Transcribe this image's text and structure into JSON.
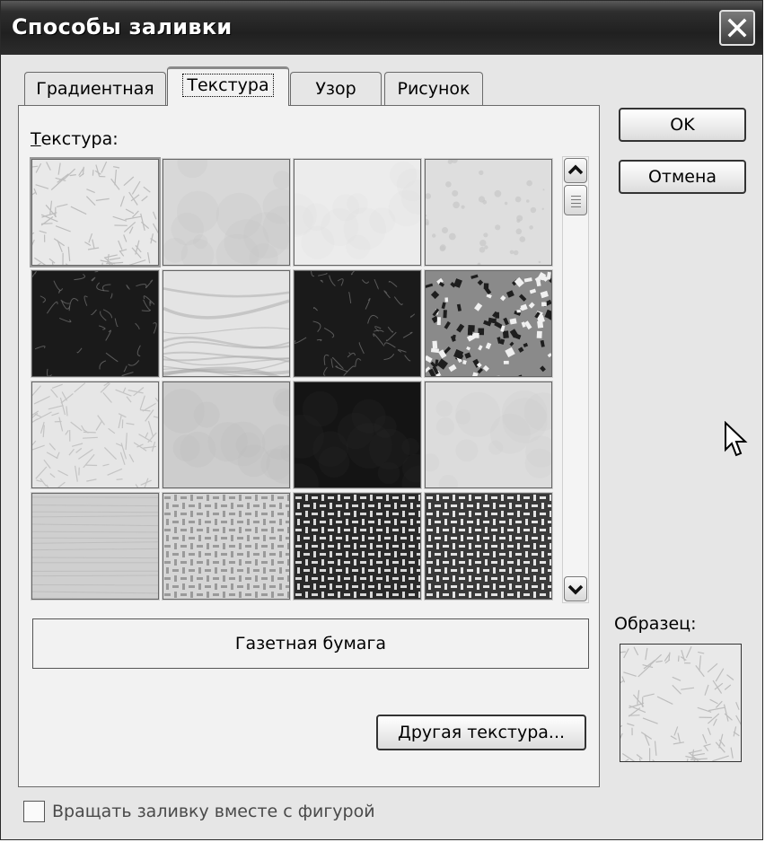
{
  "dialog": {
    "title": "Способы заливки"
  },
  "tabs": [
    {
      "label": "Градиентная",
      "active": false
    },
    {
      "label": "Текстура",
      "active": true
    },
    {
      "label": "Узор",
      "active": false
    },
    {
      "label": "Рисунок",
      "active": false
    }
  ],
  "texture_section": {
    "label_first": "Т",
    "label_rest": "екстура:",
    "textures": [
      {
        "tone": "light",
        "base": "#e9e9e9",
        "accent": "#bdbdbd",
        "pattern": "fibers"
      },
      {
        "tone": "light",
        "base": "#d8d8d8",
        "accent": "#c4c4c4",
        "pattern": "smooth"
      },
      {
        "tone": "light",
        "base": "#ececec",
        "accent": "#e0e0e0",
        "pattern": "smooth"
      },
      {
        "tone": "light",
        "base": "#dedede",
        "accent": "#c8c8c8",
        "pattern": "drops"
      },
      {
        "tone": "dark",
        "base": "#1a1a1a",
        "accent": "#6a6a6a",
        "pattern": "granite"
      },
      {
        "tone": "light",
        "base": "#e4e4e4",
        "accent": "#a8a8a8",
        "pattern": "marble"
      },
      {
        "tone": "dark",
        "base": "#1a1a1a",
        "accent": "#6a6a6a",
        "pattern": "granite"
      },
      {
        "tone": "mixed",
        "base": "#8a8a8a",
        "accent": "#1e1e1e",
        "pattern": "mosaic"
      },
      {
        "tone": "light",
        "base": "#e6e6e6",
        "accent": "#c4c4c4",
        "pattern": "fibers"
      },
      {
        "tone": "light",
        "base": "#cdcdcd",
        "accent": "#bcbcbc",
        "pattern": "smooth"
      },
      {
        "tone": "dark",
        "base": "#141414",
        "accent": "#262626",
        "pattern": "smooth"
      },
      {
        "tone": "light",
        "base": "#dcdcdc",
        "accent": "#cacaca",
        "pattern": "smooth"
      },
      {
        "tone": "light",
        "base": "#cfcfcf",
        "accent": "#b8b8b8",
        "pattern": "wood"
      },
      {
        "tone": "light",
        "base": "#d6d6d6",
        "accent": "#9a9a9a",
        "pattern": "weave"
      },
      {
        "tone": "dark",
        "base": "#2a2a2a",
        "accent": "#d8d8d8",
        "pattern": "weave"
      },
      {
        "tone": "dark",
        "base": "#3a3a3a",
        "accent": "#e4e4e4",
        "pattern": "weave"
      }
    ],
    "selected_index": 0
  },
  "selected_texture_name": "Газетная бумага",
  "buttons": {
    "other_texture_first": "Д",
    "other_texture_rest": "ругая текстура...",
    "ok": "OK",
    "cancel": "Отмена"
  },
  "sample": {
    "label": "Образец:"
  },
  "rotate_checkbox": {
    "label": "Вращать заливку вместе с фигурой",
    "checked": false,
    "enabled": false
  }
}
